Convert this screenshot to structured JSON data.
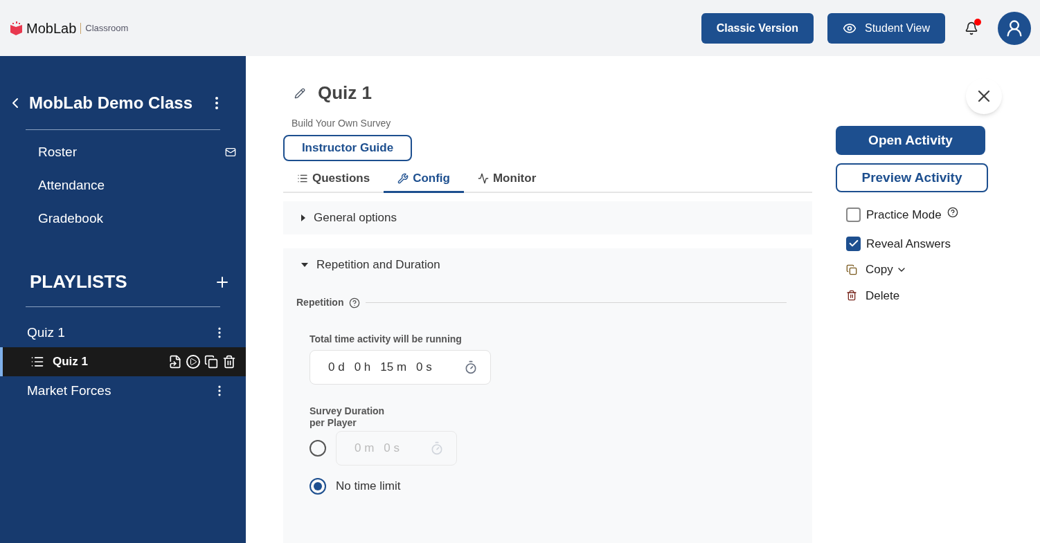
{
  "header": {
    "logo": "MobLab",
    "product": "Classroom",
    "buttons": [
      {
        "label": "Classic Version",
        "kind": "plain"
      },
      {
        "label": "Student View",
        "kind": "eye"
      }
    ],
    "notifications_unread": true
  },
  "sidebar": {
    "class_name": "MobLab Demo Class",
    "nav": [
      {
        "label": "Roster",
        "kind": "mail"
      },
      {
        "label": "Attendance",
        "kind": "plain"
      },
      {
        "label": "Gradebook",
        "kind": "plain"
      }
    ],
    "playlists_title": "PLAYLISTS",
    "playlists": [
      {
        "label": "Quiz 1",
        "selected": false,
        "children": [
          {
            "label": "Quiz 1",
            "selected": true
          }
        ]
      },
      {
        "label": "Market Forces",
        "selected": false
      }
    ]
  },
  "main": {
    "title": "Quiz 1",
    "subtitle": "Build Your Own Survey",
    "guide_button": "Instructor Guide",
    "tabs": [
      {
        "label": "Questions",
        "kind": "list",
        "selected": false
      },
      {
        "label": "Config",
        "kind": "tools",
        "selected": true
      },
      {
        "label": "Monitor",
        "kind": "pulse",
        "selected": false
      }
    ],
    "sections": [
      {
        "title": "General options",
        "expanded": false
      },
      {
        "title": "Repetition and Duration",
        "expanded": true
      }
    ],
    "repetition_label": "Repetition",
    "total_time_label": "Total time activity will be running",
    "total_time": [
      "0 d",
      "0 h",
      "15 m",
      "0 s"
    ],
    "duration_label": "Survey Duration per Player",
    "duration_options": [
      {
        "kind": "timer",
        "selected": false,
        "disabled": true,
        "fields": [
          "0 m",
          "0 s"
        ]
      },
      {
        "kind": "text",
        "selected": true,
        "label": "No time limit"
      }
    ]
  },
  "actions": {
    "open": "Open Activity",
    "preview": "Preview Activity",
    "options": [
      {
        "label": "Practice Mode",
        "checked": false,
        "help": true
      },
      {
        "label": "Reveal Answers",
        "checked": true,
        "help": false
      }
    ],
    "links": [
      {
        "label": "Copy",
        "kind": "copy"
      },
      {
        "label": "Delete",
        "kind": "delete"
      }
    ]
  }
}
